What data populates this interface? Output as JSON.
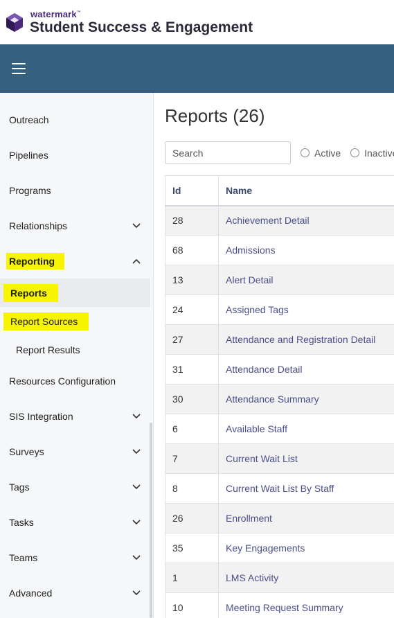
{
  "brand": {
    "small": "watermark",
    "tm": "™",
    "title": "Student Success & Engagement"
  },
  "sidebar": {
    "items": [
      {
        "label": "Outreach"
      },
      {
        "label": "Pipelines"
      },
      {
        "label": "Programs"
      },
      {
        "label": "Relationships"
      },
      {
        "label": "Reporting"
      },
      {
        "label": "Reports"
      },
      {
        "label": "Report Sources"
      },
      {
        "label": "Report Results"
      },
      {
        "label": "Resources Configuration"
      },
      {
        "label": "SIS Integration"
      },
      {
        "label": "Surveys"
      },
      {
        "label": "Tags"
      },
      {
        "label": "Tasks"
      },
      {
        "label": "Teams"
      },
      {
        "label": "Advanced"
      }
    ]
  },
  "main": {
    "title": "Reports (26)",
    "search_placeholder": "Search",
    "radio_active": "Active",
    "radio_inactive": "Inactive",
    "columns": {
      "id": "Id",
      "name": "Name"
    },
    "rows": [
      {
        "id": "28",
        "name": "Achievement Detail"
      },
      {
        "id": "68",
        "name": "Admissions"
      },
      {
        "id": "13",
        "name": "Alert Detail"
      },
      {
        "id": "24",
        "name": "Assigned Tags"
      },
      {
        "id": "27",
        "name": "Attendance and Registration Detail"
      },
      {
        "id": "31",
        "name": "Attendance Detail"
      },
      {
        "id": "30",
        "name": "Attendance Summary"
      },
      {
        "id": "6",
        "name": "Available Staff"
      },
      {
        "id": "7",
        "name": "Current Wait List"
      },
      {
        "id": "8",
        "name": "Current Wait List By Staff"
      },
      {
        "id": "26",
        "name": "Enrollment"
      },
      {
        "id": "35",
        "name": "Key Engagements"
      },
      {
        "id": "1",
        "name": "LMS Activity"
      },
      {
        "id": "10",
        "name": "Meeting Request Summary"
      }
    ]
  },
  "colors": {
    "navbar": "#35607f",
    "highlight": "#f7f500",
    "link": "#4a4f8a",
    "logo": "#4b2a7b"
  }
}
